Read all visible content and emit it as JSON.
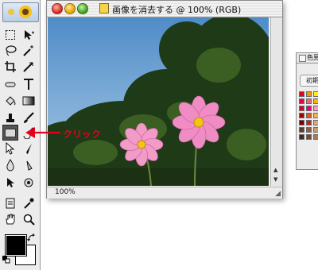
{
  "window": {
    "title": "画像を消去する @ 100% (RGB)",
    "zoom": "100%"
  },
  "color_panel": {
    "title": "色見",
    "tab_label": "初期"
  },
  "annotation": {
    "label": "クリック",
    "color": "#e6001e"
  },
  "toolbox": {
    "tools": [
      "marquee-tool",
      "move-tool",
      "lasso-tool",
      "magic-wand-tool",
      "crop-tool",
      "slice-tool",
      "healing-brush-tool",
      "brush-tool",
      "stamp-tool",
      "history-brush-tool",
      "eraser-tool",
      "gradient-tool",
      "blur-tool",
      "dodge-tool",
      "path-selection-tool",
      "type-tool",
      "pen-tool",
      "shape-tool",
      "notes-tool",
      "eyedropper-tool",
      "hand-tool",
      "zoom-tool"
    ],
    "foreground_color": "#000000",
    "background_color": "#ffffff"
  },
  "colors": {
    "accent_red": "#e6001e"
  }
}
